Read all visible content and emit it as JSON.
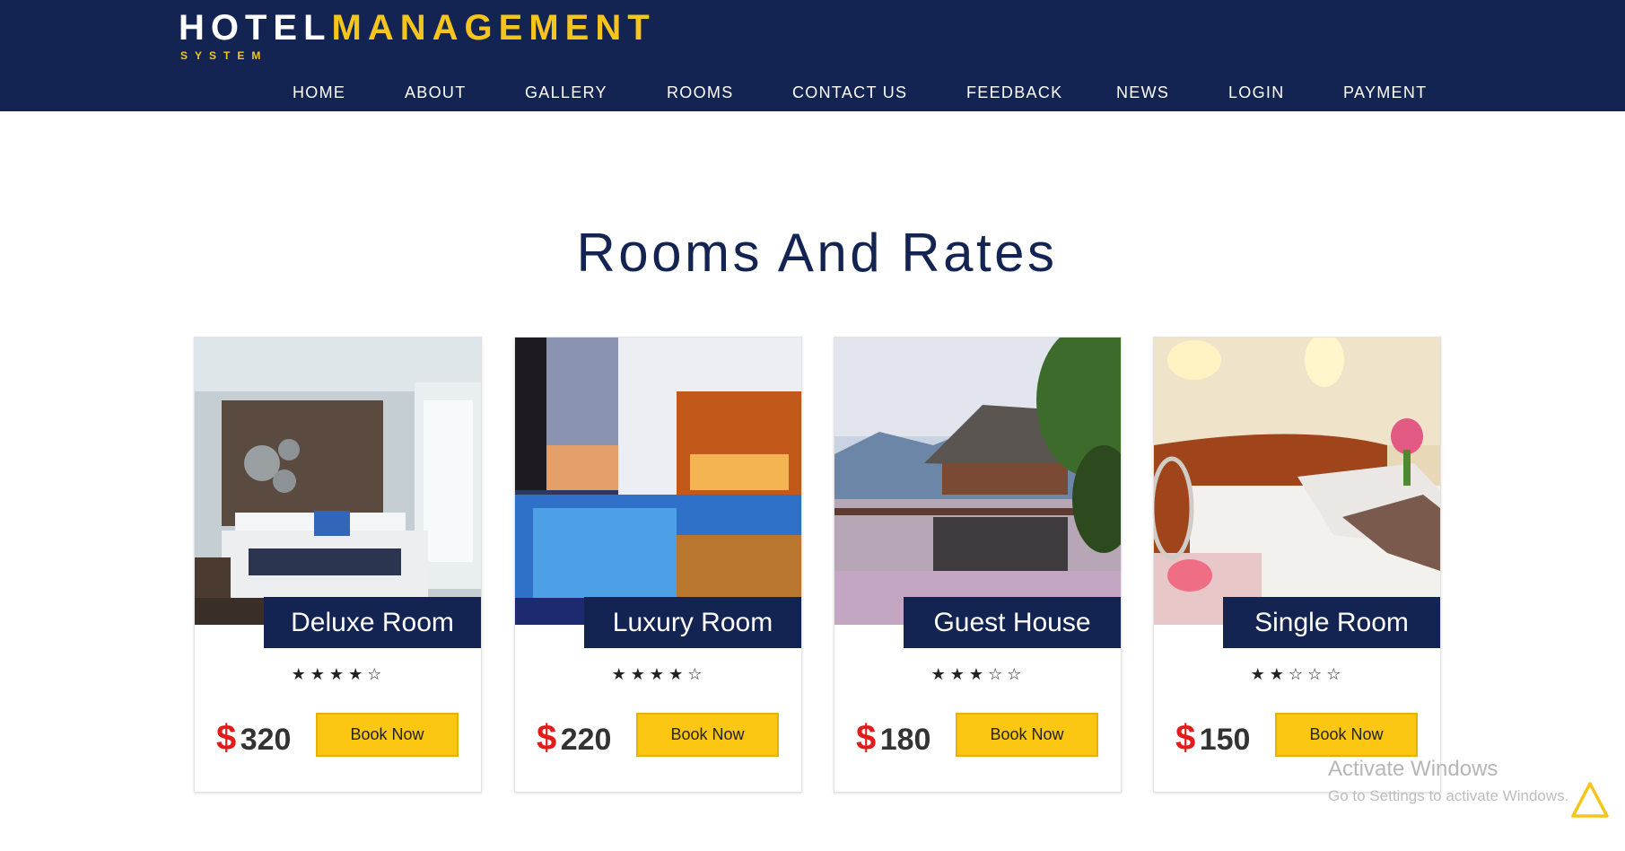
{
  "brand": {
    "part1": "HOTEL",
    "part2": "MANAGEMENT",
    "sub": "SYSTEM"
  },
  "nav": {
    "items": [
      {
        "label": "HOME"
      },
      {
        "label": "ABOUT"
      },
      {
        "label": "GALLERY"
      },
      {
        "label": "ROOMS"
      },
      {
        "label": "CONTACT US"
      },
      {
        "label": "FEEDBACK"
      },
      {
        "label": "NEWS"
      },
      {
        "label": "LOGIN"
      },
      {
        "label": "PAYMENT"
      }
    ]
  },
  "page": {
    "title": "Rooms And Rates"
  },
  "rooms": [
    {
      "name": "Deluxe Room",
      "stars": "★★★★☆",
      "rating": 4,
      "currency": "$",
      "price": "320",
      "button": "Book Now"
    },
    {
      "name": "Luxury Room",
      "stars": "★★★★☆",
      "rating": 4,
      "currency": "$",
      "price": "220",
      "button": "Book Now"
    },
    {
      "name": "Guest House",
      "stars": "★★★☆☆",
      "rating": 3,
      "currency": "$",
      "price": "180",
      "button": "Book Now"
    },
    {
      "name": "Single Room",
      "stars": "★★☆☆☆",
      "rating": 2,
      "currency": "$",
      "price": " 150",
      "button": "Book Now"
    }
  ],
  "watermark": {
    "title": "Activate Windows",
    "sub": "Go to Settings to activate Windows."
  },
  "colors": {
    "navy": "#132352",
    "gold": "#f6c51c",
    "button": "#fbc712",
    "price_symbol": "#e21b1b"
  }
}
